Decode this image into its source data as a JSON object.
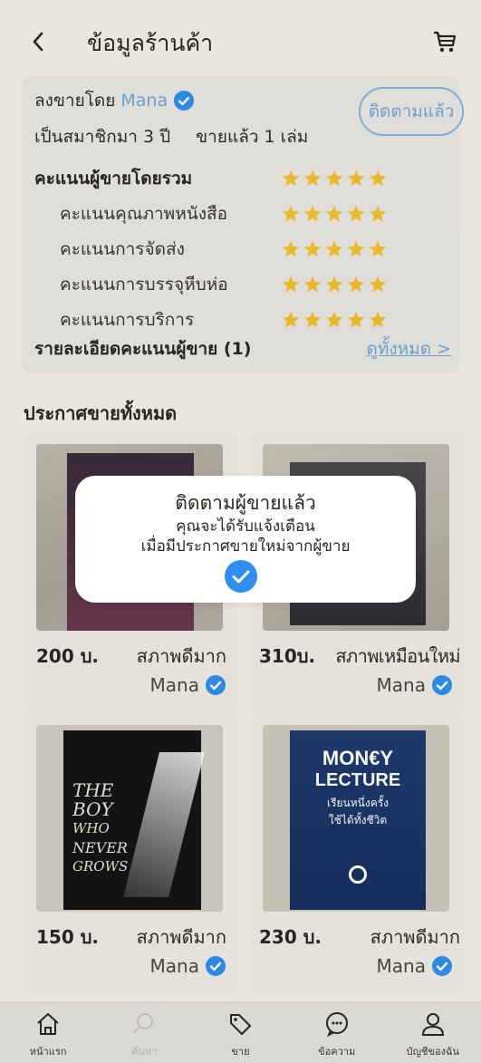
{
  "header": {
    "title": "ข้อมูลร้านค้า",
    "back_icon": "chevron-left-icon",
    "cart_icon": "cart-icon"
  },
  "seller": {
    "posted_by_label": "ลงขายโดย",
    "name": "Mana",
    "member_text": "เป็นสมาชิกมา 3 ปี",
    "sold_text": "ขายแล้ว 1 เล่ม",
    "follow_label": "ติดตามแล้ว",
    "ratings": [
      {
        "label": "คะแนนผู้ขายโดยรวม",
        "stars": 5
      },
      {
        "label": "คะแนนคุณภาพหนังสือ",
        "stars": 5
      },
      {
        "label": "คะแนนการจัดส่ง",
        "stars": 5
      },
      {
        "label": "คะแนนการบรรจุหีบห่อ",
        "stars": 5
      },
      {
        "label": "คะแนนการบริการ",
        "stars": 5
      }
    ],
    "details_title": "รายละเอียดคะแนนผู้ขาย (1)",
    "see_all": "ดูทั้งหมด >"
  },
  "listings_title": "ประกาศขายทั้งหมด",
  "listings": [
    {
      "price": "200 บ.",
      "condition": "สภาพดีมาก",
      "seller": "Mana"
    },
    {
      "price": "310บ.",
      "condition": "สภาพเหมือนใหม่",
      "seller": "Mana"
    },
    {
      "price": "150 บ.",
      "condition": "สภาพดีมาก",
      "seller": "Mana",
      "cover_lines": [
        "THE",
        "BOY",
        "WHO",
        "NEVER",
        "GROWS"
      ]
    },
    {
      "price": "230 บ.",
      "condition": "สภาพดีมาก",
      "seller": "Mana",
      "cover_lines": [
        "MON€Y",
        "LECTURE",
        "เรียนหนึ่งครั้ง",
        "ใช้ได้ทั้งชีวิต"
      ]
    }
  ],
  "toast": {
    "title": "ติดตามผู้ขายแล้ว",
    "line1": "คุณจะได้รับแจ้งเตือน",
    "line2": "เมื่อมีประกาศขายใหม่จากผู้ขาย"
  },
  "nav": [
    {
      "label": "หน้าแรก",
      "icon": "home-icon"
    },
    {
      "label": "ค้นหา",
      "icon": "search-icon"
    },
    {
      "label": "ขาย",
      "icon": "tag-icon"
    },
    {
      "label": "ข้อความ",
      "icon": "chat-icon"
    },
    {
      "label": "บัญชีของฉัน",
      "icon": "user-icon"
    }
  ],
  "colors": {
    "accent": "#6fa7d8",
    "verified": "#2e8ff0",
    "star": "#f2c12e"
  }
}
